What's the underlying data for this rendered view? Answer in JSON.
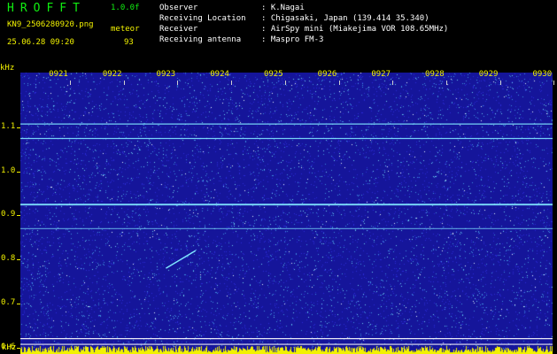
{
  "header": {
    "logo": "HROFFT",
    "version": "1.0.0f",
    "filename": "KN9_2506280920.png",
    "mode_label": "meteor",
    "datetime": "25.06.28 09:20",
    "count": "93",
    "fields": [
      {
        "label": "Observer",
        "value": ": K.Nagai"
      },
      {
        "label": "Receiving Location",
        "value": ": Chigasaki, Japan (139.414 35.340)"
      },
      {
        "label": "Receiver",
        "value": ": AirSpy mini (Miakejima VOR 108.65MHz)"
      },
      {
        "label": "Receiving antenna",
        "value": ": Maspro FM-3"
      }
    ]
  },
  "spectrogram": {
    "unit_label": "kHz",
    "y_unit_bottom": "kHz",
    "y_ticks": [
      {
        "label": "1.1",
        "value": 1.1
      },
      {
        "label": "1.0",
        "value": 1.0
      },
      {
        "label": "0.9",
        "value": 0.9
      },
      {
        "label": "0.8",
        "value": 0.8
      },
      {
        "label": "0.7",
        "value": 0.7
      },
      {
        "label": "0.6",
        "value": 0.6
      }
    ],
    "y_range": [
      0.585,
      1.225
    ],
    "time_ticks": [
      "0921",
      "0922",
      "0923",
      "0924",
      "0925",
      "0926",
      "0927",
      "0928",
      "0929",
      "0930"
    ],
    "background_color": "#15159a",
    "trace_color": "#7fe6ff",
    "carrier_lines_khz": [
      1.108,
      1.075,
      0.925,
      0.87,
      0.62,
      0.607
    ],
    "echo": {
      "start_min": 2.0,
      "end_min": 2.55,
      "start_khz": 0.78,
      "end_khz": 0.82
    }
  }
}
